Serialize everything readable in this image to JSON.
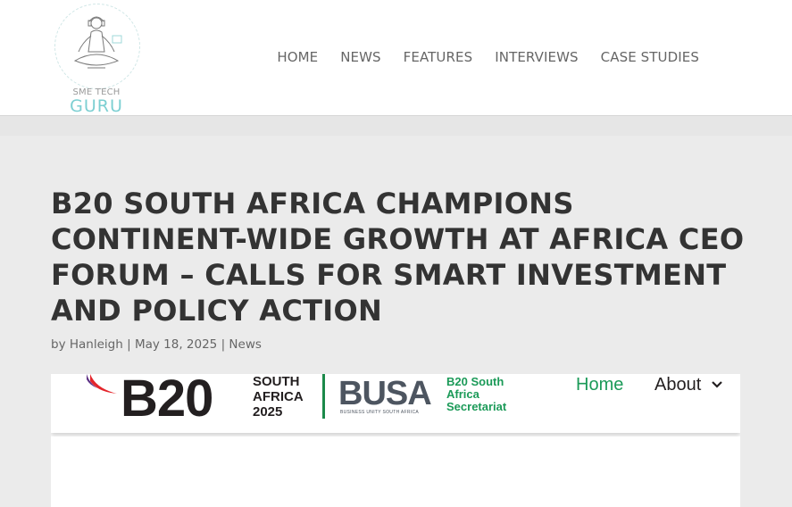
{
  "header": {
    "logo": {
      "line1": "SME TECH",
      "line2": "GURU",
      "icon": "meditating-figure-icon",
      "accent": "#7ccfd2"
    },
    "nav": [
      {
        "label": "HOME"
      },
      {
        "label": "NEWS"
      },
      {
        "label": "FEATURES"
      },
      {
        "label": "INTERVIEWS"
      },
      {
        "label": "CASE STUDIES"
      }
    ]
  },
  "article": {
    "title": "B20 SOUTH AFRICA CHAMPIONS CONTINENT-WIDE GROWTH AT AFRICA CEO FORUM – CALLS FOR SMART INVESTMENT AND POLICY ACTION",
    "meta": {
      "by": "by",
      "author": "Hanleigh",
      "sep1": "|",
      "date": "May 18, 2025",
      "sep2": "|",
      "category": "News"
    }
  },
  "featured_image": {
    "b20": "B20",
    "sa_line1": "SOUTH",
    "sa_line2": "AFRICA",
    "sa_line3": "2025",
    "busa": "BUSA",
    "busa_sub": "BUSINESS UNITY SOUTH AFRICA",
    "sec_line1": "B20 South",
    "sec_line2": "Africa",
    "sec_line3": "Secretariat",
    "nav_home": "Home",
    "nav_about": "About",
    "colors": {
      "green": "#1b9a58",
      "dark": "#231f20",
      "grey": "#4d5560"
    }
  }
}
